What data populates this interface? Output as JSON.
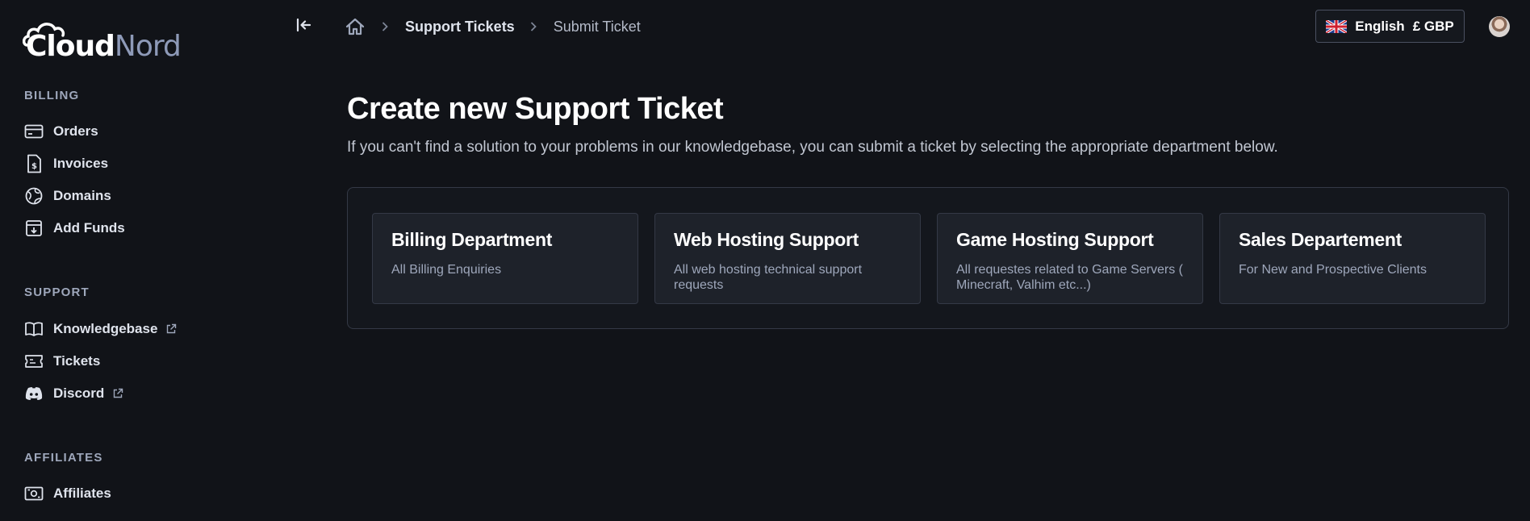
{
  "brand": {
    "part1": "Cloud",
    "part2": "Nord"
  },
  "sidebar": {
    "sections": [
      {
        "title": "BILLING",
        "items": [
          {
            "label": "Orders",
            "icon": "credit-card-icon"
          },
          {
            "label": "Invoices",
            "icon": "invoice-dollar-icon"
          },
          {
            "label": "Domains",
            "icon": "globe-icon"
          },
          {
            "label": "Add Funds",
            "icon": "download-box-icon"
          }
        ]
      },
      {
        "title": "SUPPORT",
        "items": [
          {
            "label": "Knowledgebase",
            "icon": "book-icon",
            "external": true
          },
          {
            "label": "Tickets",
            "icon": "ticket-icon"
          },
          {
            "label": "Discord",
            "icon": "discord-icon",
            "external": true
          }
        ]
      },
      {
        "title": "AFFILIATES",
        "items": [
          {
            "label": "Affiliates",
            "icon": "cash-icon"
          }
        ]
      }
    ]
  },
  "topbar": {
    "breadcrumb": {
      "link": "Support Tickets",
      "current": "Submit Ticket"
    },
    "language_label": "English",
    "currency_label": "£ GBP"
  },
  "main": {
    "title": "Create new Support Ticket",
    "subtitle": "If you can't find a solution to your problems in our knowledgebase, you can submit a ticket by selecting the appropriate department below.",
    "departments": [
      {
        "name": "Billing Department",
        "description": "All Billing Enquiries"
      },
      {
        "name": "Web Hosting Support",
        "description": "All web hosting technical support requests"
      },
      {
        "name": "Game Hosting Support",
        "description": "All requestes related to Game Servers ( Minecraft, Valhim etc...)"
      },
      {
        "name": "Sales Departement",
        "description": "For New and Prospective Clients"
      }
    ]
  },
  "colors": {
    "background": "#111318",
    "card": "#1e222a",
    "border": "#343946",
    "muted": "#9ea7bb"
  }
}
